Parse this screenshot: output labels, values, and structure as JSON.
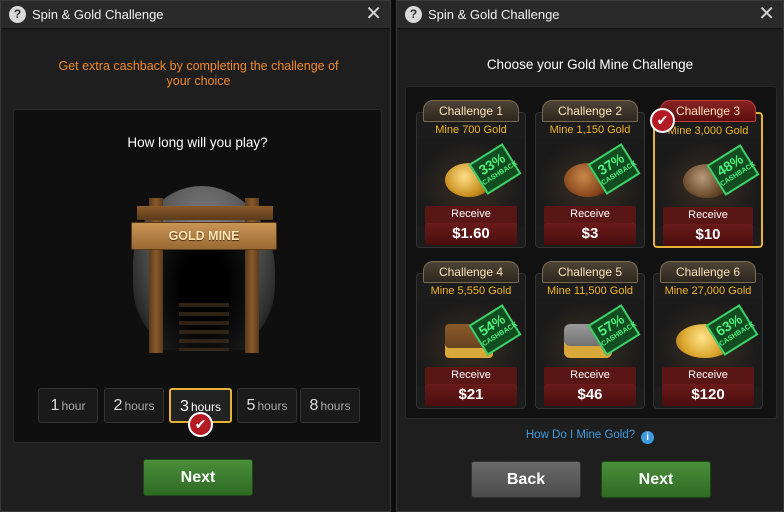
{
  "left_dialog": {
    "title": "Spin & Gold Challenge",
    "help_glyph": "?",
    "close_glyph": "✕",
    "promo_line1": "Get extra cashback by completing the challenge of",
    "promo_line2": "your choice",
    "question": "How long will you play?",
    "mine_sign": "GOLD MINE",
    "hours": [
      {
        "num": "1",
        "unit": "hour"
      },
      {
        "num": "2",
        "unit": "hours"
      },
      {
        "num": "3",
        "unit": "hours"
      },
      {
        "num": "5",
        "unit": "hours"
      },
      {
        "num": "8",
        "unit": "hours"
      }
    ],
    "selected_hour_index": 2,
    "next_label": "Next"
  },
  "right_dialog": {
    "title": "Spin & Gold Challenge",
    "help_glyph": "?",
    "close_glyph": "✕",
    "heading": "Choose your Gold Mine Challenge",
    "receive_label": "Receive",
    "cashback_label": "CASHBACK",
    "challenges": [
      {
        "tag": "Challenge 1",
        "mine": "Mine 700 Gold",
        "pct": "33%",
        "amount": "$1.60"
      },
      {
        "tag": "Challenge 2",
        "mine": "Mine 1,150 Gold",
        "pct": "37%",
        "amount": "$3"
      },
      {
        "tag": "Challenge 3",
        "mine": "Mine 3,000 Gold",
        "pct": "48%",
        "amount": "$10"
      },
      {
        "tag": "Challenge 4",
        "mine": "Mine 5,550 Gold",
        "pct": "54%",
        "amount": "$21"
      },
      {
        "tag": "Challenge 5",
        "mine": "Mine 11,500 Gold",
        "pct": "57%",
        "amount": "$46"
      },
      {
        "tag": "Challenge 6",
        "mine": "Mine 27,000 Gold",
        "pct": "63%",
        "amount": "$120"
      }
    ],
    "selected_challenge_index": 2,
    "help_link": "How Do I Mine Gold?",
    "info_glyph": "i",
    "back_label": "Back",
    "next_label": "Next"
  },
  "check_glyph": "✔",
  "colors": {
    "accent_gold": "#e6b23a",
    "promo_orange": "#f0892a",
    "cashback_green": "#4ef07a",
    "link_blue": "#3f9be0",
    "button_green": "#3d7d30",
    "receive_red": "#5a1515"
  }
}
